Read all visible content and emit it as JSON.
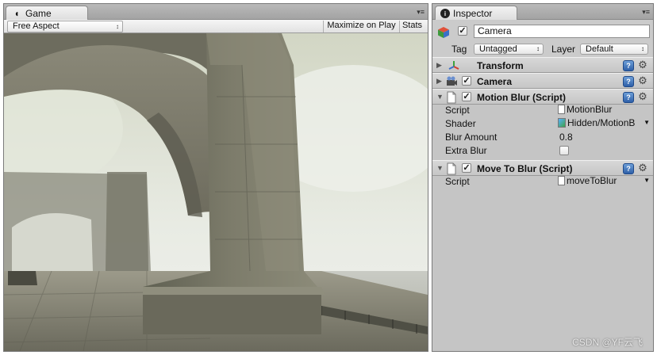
{
  "game_panel": {
    "tab_label": "Game",
    "aspect_select": "Free Aspect",
    "maximize_on_play": "Maximize on Play",
    "stats": "Stats"
  },
  "inspector": {
    "tab_label": "Inspector",
    "object_name": "Camera",
    "tag_label": "Tag",
    "tag_value": "Untagged",
    "layer_label": "Layer",
    "layer_value": "Default",
    "components": {
      "transform": {
        "title": "Transform"
      },
      "camera": {
        "title": "Camera",
        "enabled": true
      },
      "motion_blur": {
        "title": "Motion Blur (Script)",
        "enabled": true,
        "script_label": "Script",
        "script_value": "MotionBlur",
        "shader_label": "Shader",
        "shader_value": "Hidden/MotionB",
        "blur_amount_label": "Blur Amount",
        "blur_amount_value": "0.8",
        "extra_blur_label": "Extra Blur",
        "extra_blur_checked": false
      },
      "move_to_blur": {
        "title": "Move To Blur (Script)",
        "enabled": true,
        "script_label": "Script",
        "script_value": "moveToBlur"
      }
    }
  },
  "watermark": "CSDN @YF云飞",
  "colors": {
    "panel_bg": "#c5c5c5",
    "help_blue": "#2e5fa8",
    "sky": "#dfe3d6",
    "stone": "#7b7a6c"
  }
}
